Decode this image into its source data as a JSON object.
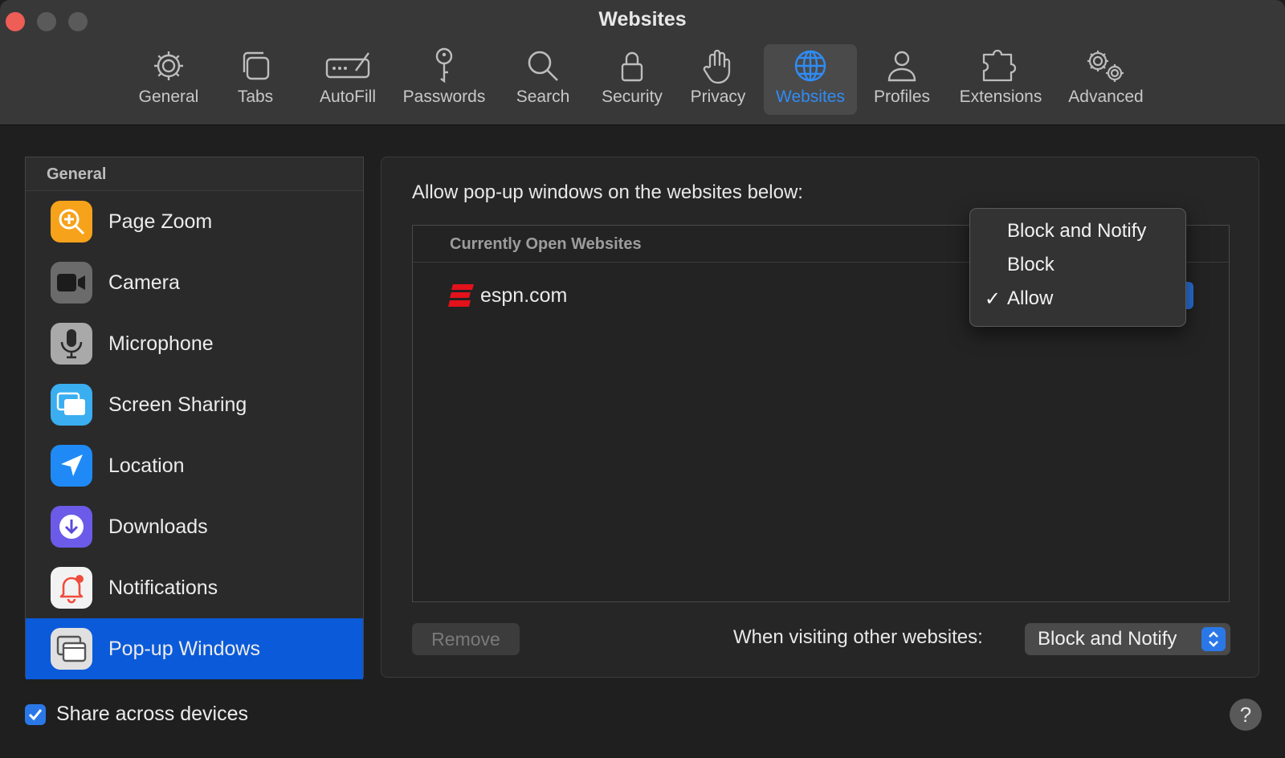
{
  "window": {
    "title": "Websites"
  },
  "toolbar": {
    "tabs": [
      {
        "label": "General",
        "icon": "gear-icon"
      },
      {
        "label": "Tabs",
        "icon": "tabs-icon"
      },
      {
        "label": "AutoFill",
        "icon": "autofill-icon"
      },
      {
        "label": "Passwords",
        "icon": "key-icon"
      },
      {
        "label": "Search",
        "icon": "magnifier-icon"
      },
      {
        "label": "Security",
        "icon": "lock-icon"
      },
      {
        "label": "Privacy",
        "icon": "hand-icon"
      },
      {
        "label": "Websites",
        "icon": "globe-icon",
        "active": true
      },
      {
        "label": "Profiles",
        "icon": "person-icon"
      },
      {
        "label": "Extensions",
        "icon": "puzzle-icon"
      },
      {
        "label": "Advanced",
        "icon": "gears-icon"
      }
    ]
  },
  "sidebar": {
    "header": "General",
    "items": [
      {
        "label": "Page Zoom",
        "icon": "zoom-icon",
        "color": "#f7a21b"
      },
      {
        "label": "Camera",
        "icon": "camera-icon",
        "color": "#6b6b6b"
      },
      {
        "label": "Microphone",
        "icon": "microphone-icon",
        "color": "#9a9a9a"
      },
      {
        "label": "Screen Sharing",
        "icon": "screen-sharing-icon",
        "color": "#3aaef0"
      },
      {
        "label": "Location",
        "icon": "location-icon",
        "color": "#1f8af5"
      },
      {
        "label": "Downloads",
        "icon": "downloads-icon",
        "color": "#6b5be8"
      },
      {
        "label": "Notifications",
        "icon": "notifications-icon",
        "color": "#f2f2f2"
      },
      {
        "label": "Pop-up Windows",
        "icon": "popup-windows-icon",
        "color": "#e0e0e0",
        "active": true
      }
    ]
  },
  "main": {
    "title": "Allow pop-up windows on the websites below:",
    "list_header": "Currently Open Websites",
    "sites": [
      {
        "name": "espn.com",
        "icon": "espn-icon"
      }
    ],
    "remove_label": "Remove",
    "visiting_label": "When visiting other websites:",
    "visiting_value": "Block and Notify"
  },
  "dropdown": {
    "options": [
      {
        "label": "Block and Notify",
        "checked": false
      },
      {
        "label": "Block",
        "checked": false
      },
      {
        "label": "Allow",
        "checked": true
      }
    ],
    "check_mark": "✓"
  },
  "footer": {
    "share_label": "Share across devices",
    "share_checked": true,
    "help_label": "?"
  },
  "colors": {
    "accent": "#2a78e8",
    "selection": "#0b5ad9",
    "close": "#ee5d56"
  }
}
